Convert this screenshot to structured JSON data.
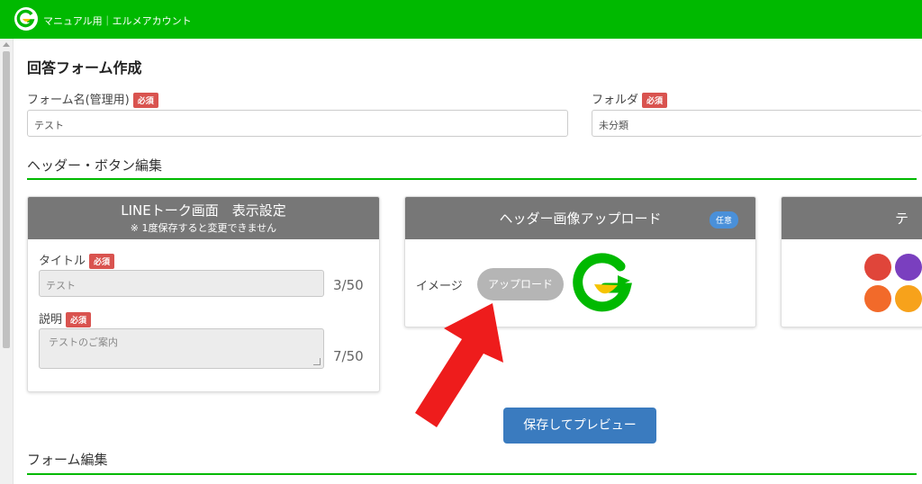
{
  "header": {
    "account_name": "マニュアル用｜エルメアカウント"
  },
  "page": {
    "title": "回答フォーム作成"
  },
  "required_badge": "必須",
  "optional_badge": "任意",
  "form_name": {
    "label": "フォーム名(管理用)",
    "value": "テスト"
  },
  "folder": {
    "label": "フォルダ",
    "value": "未分類"
  },
  "section_header_button": "ヘッダー・ボタン編集",
  "line_talk": {
    "title": "LINEトーク画面　表示設定",
    "subtitle": "※ 1度保存すると変更できません",
    "title_label": "タイトル",
    "title_value": "テスト",
    "title_count": "3/50",
    "desc_label": "説明",
    "desc_value": "テストのご案内",
    "desc_count": "7/50"
  },
  "header_image": {
    "title": "ヘッダー画像アップロード",
    "image_label": "イメージ",
    "upload_label": "アップロード"
  },
  "theme": {
    "title_partial": "テ"
  },
  "theme_colors": [
    "#e0453a",
    "#7a3fbf",
    "#f26a2a",
    "#f7a21b"
  ],
  "save_preview_label": "保存してプレビュー",
  "section_form_edit": "フォーム編集",
  "colors": {
    "brand": "#00b900",
    "required": "#d9534f",
    "primary": "#3a7bbf",
    "arrow": "#ee1c1c"
  }
}
